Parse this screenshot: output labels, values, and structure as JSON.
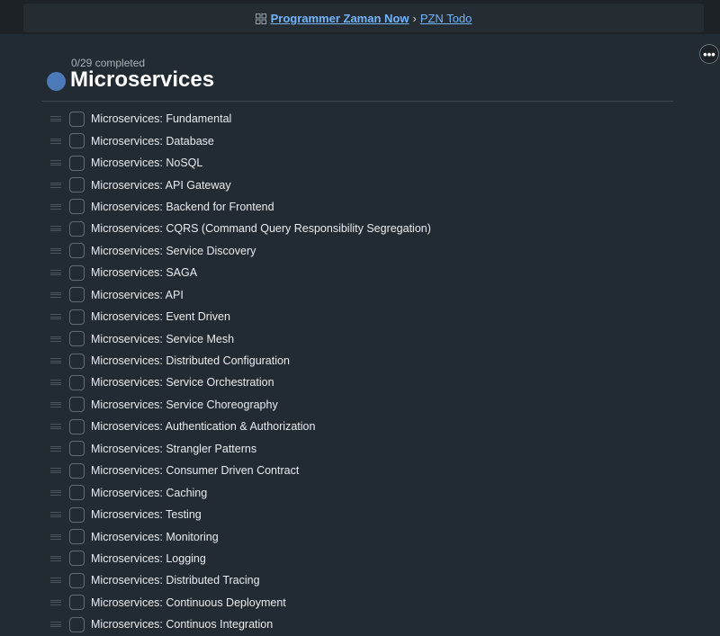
{
  "breadcrumb": {
    "workspace": "Programmer Zaman Now",
    "separator": "›",
    "project": "PZN Todo"
  },
  "more_button": {
    "label": "•••"
  },
  "header": {
    "progress_text": "0/29 completed",
    "title": "Microservices",
    "accent_color": "#4c7ab8"
  },
  "tasks": [
    {
      "label": "Microservices: Fundamental",
      "done": false
    },
    {
      "label": "Microservices: Database",
      "done": false
    },
    {
      "label": "Microservices: NoSQL",
      "done": false
    },
    {
      "label": "Microservices: API Gateway",
      "done": false
    },
    {
      "label": "Microservices: Backend for Frontend",
      "done": false
    },
    {
      "label": "Microservices: CQRS (Command Query Responsibility Segregation)",
      "done": false
    },
    {
      "label": "Microservices: Service Discovery",
      "done": false
    },
    {
      "label": "Microservices: SAGA",
      "done": false
    },
    {
      "label": "Microservices: API",
      "done": false
    },
    {
      "label": "Microservices: Event Driven",
      "done": false
    },
    {
      "label": "Microservices: Service Mesh",
      "done": false
    },
    {
      "label": "Microservices: Distributed Configuration",
      "done": false
    },
    {
      "label": "Microservices: Service Orchestration",
      "done": false
    },
    {
      "label": "Microservices: Service Choreography",
      "done": false
    },
    {
      "label": "Microservices: Authentication & Authorization",
      "done": false
    },
    {
      "label": "Microservices: Strangler Patterns",
      "done": false
    },
    {
      "label": "Microservices: Consumer Driven Contract",
      "done": false
    },
    {
      "label": "Microservices: Caching",
      "done": false
    },
    {
      "label": "Microservices: Testing",
      "done": false
    },
    {
      "label": "Microservices: Monitoring",
      "done": false
    },
    {
      "label": "Microservices: Logging",
      "done": false
    },
    {
      "label": "Microservices: Distributed Tracing",
      "done": false
    },
    {
      "label": "Microservices: Continuous Deployment",
      "done": false
    },
    {
      "label": "Microservices: Continuos Integration",
      "done": false
    }
  ]
}
